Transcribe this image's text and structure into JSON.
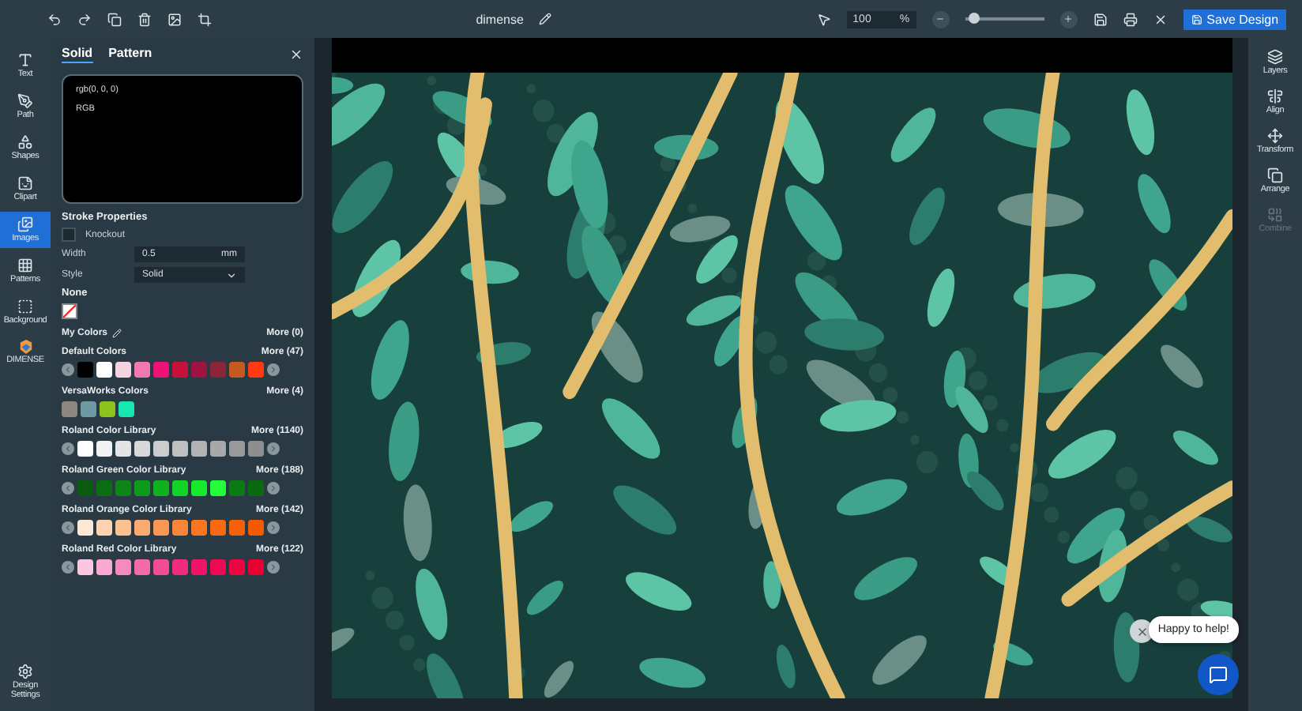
{
  "toolbar": {
    "document_name": "dimense",
    "zoom": {
      "value": "100",
      "unit": "%",
      "level": 0.1
    },
    "save_button": "Save Design"
  },
  "left_rail": [
    {
      "label": "Text",
      "selected": false
    },
    {
      "label": "Path",
      "selected": false
    },
    {
      "label": "Shapes",
      "selected": false
    },
    {
      "label": "Clipart",
      "selected": false
    },
    {
      "label": "Images",
      "selected": true
    },
    {
      "label": "Patterns",
      "selected": false
    },
    {
      "label": "Background",
      "selected": false
    },
    {
      "label": "DIMENSE",
      "selected": false
    }
  ],
  "settings": {
    "label": "Design Settings"
  },
  "panel": {
    "tabs": [
      {
        "label": "Solid",
        "selected": true
      },
      {
        "label": "Pattern",
        "selected": false
      }
    ],
    "preview": {
      "value": "rgb(0, 0, 0)",
      "mode": "RGB"
    },
    "stroke": {
      "title": "Stroke Properties",
      "knockout": {
        "label": "Knockout",
        "checked": false
      },
      "width_label": "Width",
      "width_value": "0.5",
      "width_unit": "mm",
      "style_label": "Style",
      "style_value": "Solid"
    },
    "none_label": "None",
    "my_colors": {
      "title": "My Colors",
      "more": "More (0)"
    },
    "palettes": [
      {
        "title": "Default Colors",
        "more": "More (47)",
        "arrows": true,
        "swatches": [
          {
            "color": "#000000"
          },
          {
            "color": "#ffffff"
          },
          {
            "color": "#f4d3e0"
          },
          {
            "color": "#f07ab0"
          },
          {
            "color": "#ee1177"
          },
          {
            "color": "#c8103c"
          },
          {
            "color": "#a0123f"
          },
          {
            "color": "#8a2438"
          },
          {
            "color": "#c65a1c"
          },
          {
            "color": "#ff3a10"
          }
        ]
      },
      {
        "title": "VersaWorks Colors",
        "more": "More (4)",
        "arrows": false,
        "swatches": [
          {
            "color": "#8c8680"
          },
          {
            "color": "#6f9aa3"
          },
          {
            "color": "#8dc21f"
          },
          {
            "color": "#18e8b0"
          }
        ]
      },
      {
        "title": "Roland Color Library",
        "more": "More (1140)",
        "arrows": true,
        "swatches": [
          {
            "color": "#ffffff"
          },
          {
            "color": "#f2f2f2"
          },
          {
            "color": "#e4e4e4"
          },
          {
            "color": "#d8d8d8"
          },
          {
            "color": "#cccccc"
          },
          {
            "color": "#c0c0c0"
          },
          {
            "color": "#b3b3b3"
          },
          {
            "color": "#a8a8a8"
          },
          {
            "color": "#9a9a9a"
          },
          {
            "color": "#8e8e8e"
          }
        ]
      },
      {
        "title": "Roland Green Color Library",
        "more": "More (188)",
        "arrows": true,
        "swatches": [
          {
            "color": "#0a5a0f"
          },
          {
            "color": "#0b6e12"
          },
          {
            "color": "#0c8416"
          },
          {
            "color": "#0e9a1b"
          },
          {
            "color": "#10b020"
          },
          {
            "color": "#12d426"
          },
          {
            "color": "#16ea2c"
          },
          {
            "color": "#22ff3a"
          },
          {
            "color": "#0c7a14"
          },
          {
            "color": "#0a6a12"
          }
        ]
      },
      {
        "title": "Roland Orange Color Library",
        "more": "More (142)",
        "arrows": true,
        "swatches": [
          {
            "color": "#fde8d6"
          },
          {
            "color": "#fdd2b0"
          },
          {
            "color": "#fcbf90"
          },
          {
            "color": "#fbaa70"
          },
          {
            "color": "#fa9752"
          },
          {
            "color": "#f98638"
          },
          {
            "color": "#f87622"
          },
          {
            "color": "#f76a12"
          },
          {
            "color": "#f66008"
          },
          {
            "color": "#f35a00"
          }
        ]
      },
      {
        "title": "Roland Red Color Library",
        "more": "More (122)",
        "arrows": true,
        "swatches": [
          {
            "color": "#fbc6df"
          },
          {
            "color": "#f9a8cf"
          },
          {
            "color": "#f78abd"
          },
          {
            "color": "#f56aa8"
          },
          {
            "color": "#f24c94"
          },
          {
            "color": "#f02c7e"
          },
          {
            "color": "#ee1468"
          },
          {
            "color": "#ec0a52"
          },
          {
            "color": "#ea0640"
          },
          {
            "color": "#e80030"
          }
        ]
      }
    ]
  },
  "right_rail": [
    {
      "label": "Layers",
      "disabled": false
    },
    {
      "label": "Align",
      "disabled": false
    },
    {
      "label": "Transform",
      "disabled": false
    },
    {
      "label": "Arrange",
      "disabled": false
    },
    {
      "label": "Combine",
      "disabled": true
    }
  ],
  "chat": {
    "bubble": "Happy to help!"
  }
}
